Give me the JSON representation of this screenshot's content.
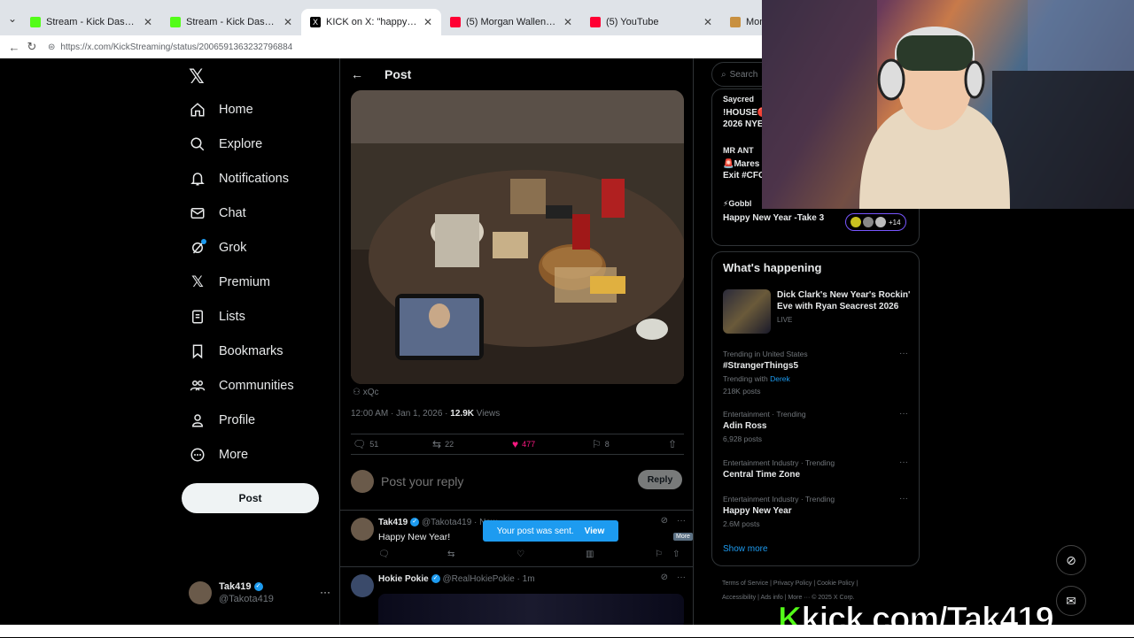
{
  "browser": {
    "tabs": [
      {
        "title": "Stream - Kick Dashboard",
        "favicon_color": "#53fc18"
      },
      {
        "title": "Stream - Kick Dashboard",
        "favicon_color": "#53fc18"
      },
      {
        "title": "KICK on X: \"happy new year https:",
        "favicon_color": "#000000"
      },
      {
        "title": "(5) Morgan Wallen - I'm The Probl",
        "favicon_color": "#ff0033"
      },
      {
        "title": "(5) YouTube",
        "favicon_color": "#ff0033"
      },
      {
        "title": "Monk",
        "favicon_color": "#c89040"
      }
    ],
    "url": "https://x.com/KickStreaming/status/2006591363232796884"
  },
  "nav": {
    "items": [
      {
        "label": "Home",
        "icon": "home-icon"
      },
      {
        "label": "Explore",
        "icon": "search-icon"
      },
      {
        "label": "Notifications",
        "icon": "bell-icon"
      },
      {
        "label": "Chat",
        "icon": "mail-icon"
      },
      {
        "label": "Grok",
        "icon": "grok-icon"
      },
      {
        "label": "Premium",
        "icon": "x-icon"
      },
      {
        "label": "Lists",
        "icon": "list-icon"
      },
      {
        "label": "Bookmarks",
        "icon": "bookmark-icon"
      },
      {
        "label": "Communities",
        "icon": "people-icon"
      },
      {
        "label": "Profile",
        "icon": "person-icon"
      },
      {
        "label": "More",
        "icon": "more-circle-icon"
      }
    ],
    "post_button": "Post",
    "account": {
      "name": "Tak419",
      "handle": "@Takota419"
    }
  },
  "main": {
    "header_title": "Post",
    "credit": "xQc",
    "time": "12:00 AM · Jan 1, 2026 · ",
    "views_count": "12.9K",
    "views_label": " Views",
    "actions": {
      "replies": "51",
      "reposts": "22",
      "likes": "477",
      "bookmarks": "8"
    },
    "reply_placeholder": "Post your reply",
    "reply_button": "Reply",
    "replies": [
      {
        "name": "Tak419",
        "handle": "@Takota419 · Now",
        "text": "Happy New Year!"
      },
      {
        "name": "Hokie Pokie",
        "handle": "@RealHokiePokie · 1m"
      }
    ],
    "tooltip": "More",
    "toast": {
      "text": "Your post was sent.",
      "action": "View"
    }
  },
  "right": {
    "search_placeholder": "Search",
    "spaces": [
      {
        "host": "Saycred",
        "title": "!HOUSE🔴",
        "title2": "2026 NYE"
      },
      {
        "host": "MR ANT",
        "title": "🚨Mares",
        "title2": "Exit #CFC"
      },
      {
        "host": "⚡Gobbl",
        "title": "Happy New Year -Take 3",
        "title2": ""
      }
    ],
    "listeners": "+14",
    "happening_title": "What's happening",
    "featured": {
      "title": "Dick Clark's New Year's Rockin' Eve with Ryan Seacrest 2026",
      "status": "LIVE"
    },
    "trends": [
      {
        "context": "Trending in United States",
        "name": "#StrangerThings5",
        "extra_prefix": "Trending with ",
        "extra_link": "Derek",
        "posts": "218K posts"
      },
      {
        "context": "Entertainment · Trending",
        "name": "Adin Ross",
        "posts": "6,928 posts"
      },
      {
        "context": "Entertainment Industry · Trending",
        "name": "Central Time Zone",
        "posts": ""
      },
      {
        "context": "Entertainment Industry · Trending",
        "name": "Happy New Year",
        "posts": "2.6M posts"
      }
    ],
    "show_more": "Show more",
    "footer_line1": "Terms of Service  |  Privacy Policy  |  Cookie Policy  |",
    "footer_line2": "Accessibility  |  Ads info  |  More ···  © 2025 X Corp."
  },
  "overlay": {
    "watermark_k": "K",
    "watermark_text": "kick.com/Tak419"
  }
}
